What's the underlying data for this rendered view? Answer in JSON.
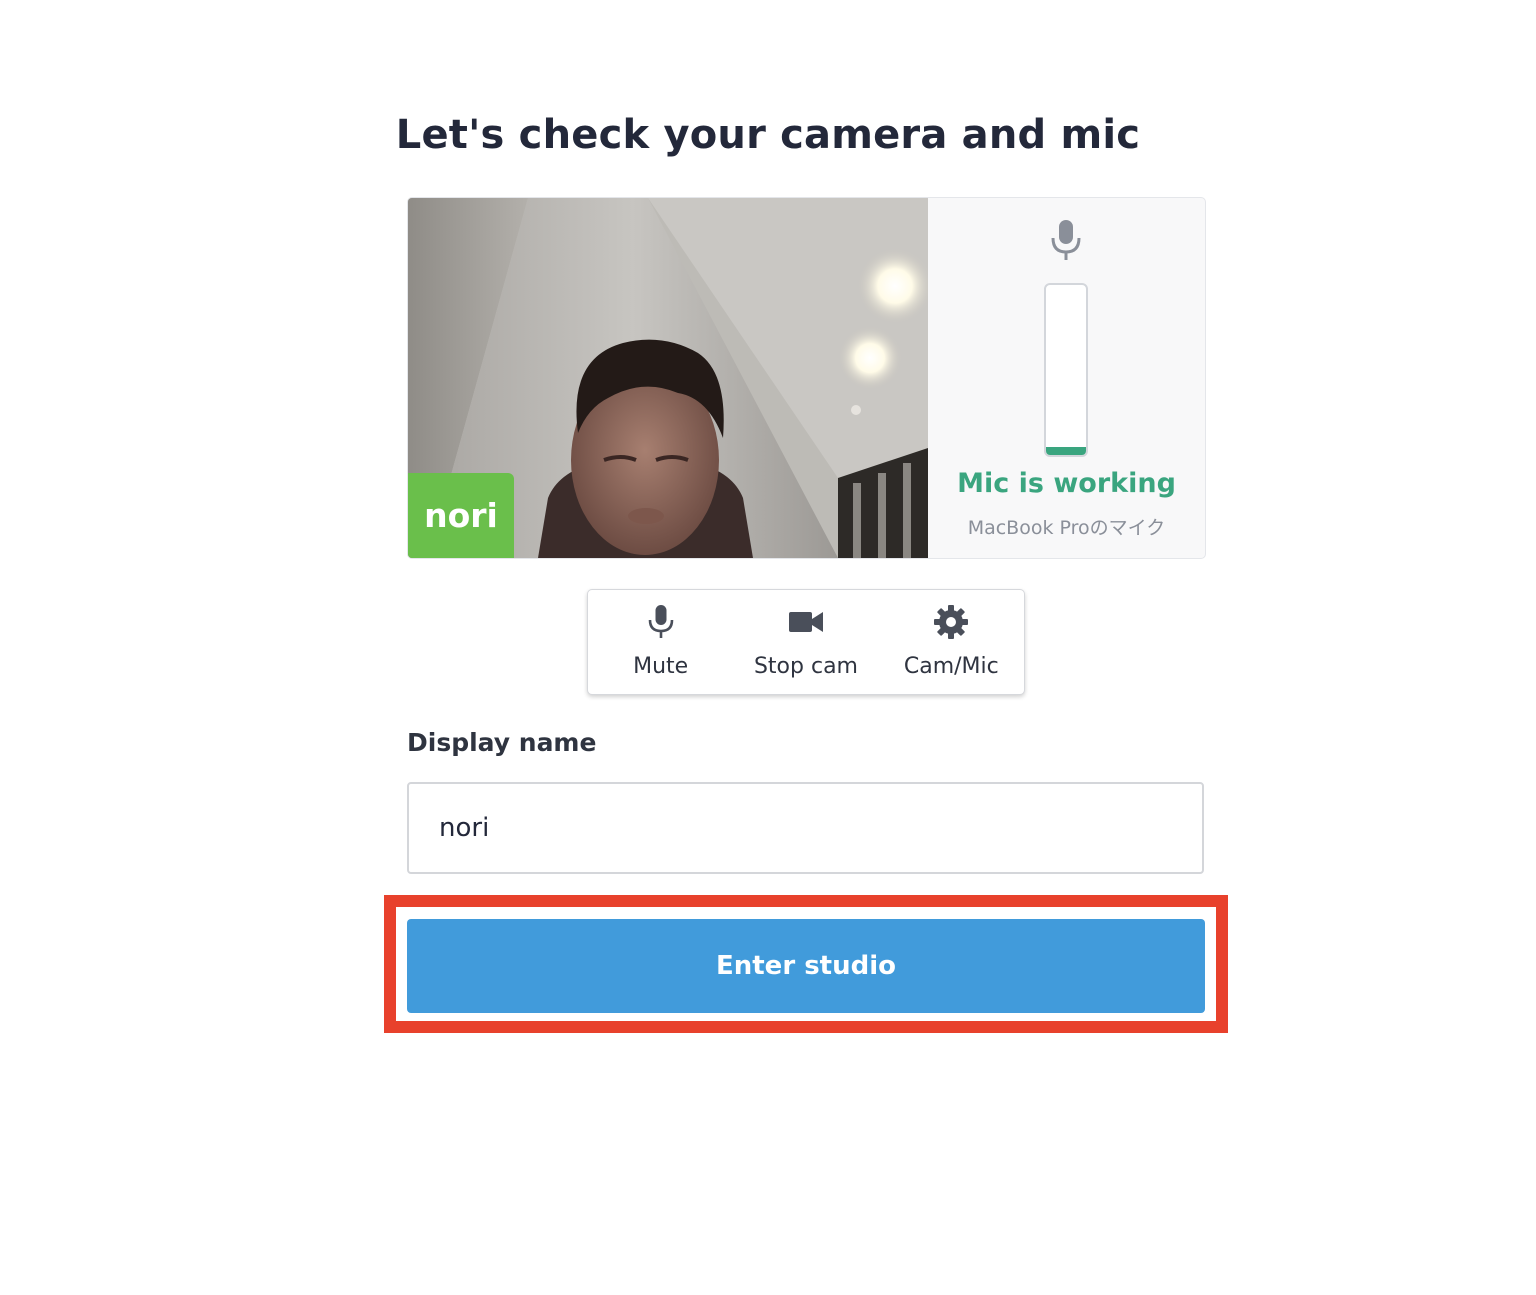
{
  "page": {
    "title": "Let's check your camera and mic"
  },
  "preview": {
    "name_tag": "nori",
    "mic_status": "Mic is working",
    "mic_device": "MacBook Proのマイク",
    "mic_level": 0.05
  },
  "controls": [
    {
      "label": "Mute",
      "icon": "microphone-icon"
    },
    {
      "label": "Stop cam",
      "icon": "video-camera-icon"
    },
    {
      "label": "Cam/Mic",
      "icon": "gear-icon"
    }
  ],
  "display_name": {
    "label": "Display name",
    "value": "nori"
  },
  "enter_button": {
    "label": "Enter studio"
  },
  "colors": {
    "accent_blue": "#419bdb",
    "mic_green": "#3aa57f",
    "name_tag_green": "#6abf4b",
    "highlight_red": "#e8412c"
  }
}
